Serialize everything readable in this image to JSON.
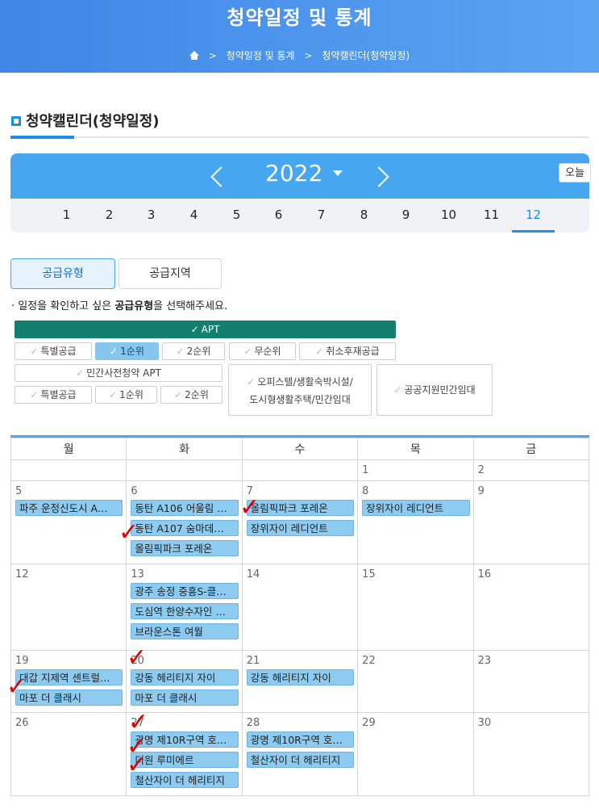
{
  "header": {
    "title": "청약일정 및 통계",
    "breadcrumb": [
      "청약일정 및 통계",
      "청약캘린더(청약일정)"
    ],
    "sep": ">"
  },
  "section": {
    "title": "청약캘린더(청약일정)"
  },
  "calendar_nav": {
    "year": "2022",
    "today_label": "오늘",
    "months": [
      "1",
      "2",
      "3",
      "4",
      "5",
      "6",
      "7",
      "8",
      "9",
      "10",
      "11",
      "12"
    ],
    "active_month": "12"
  },
  "tabs": {
    "supply_type": "공급유형",
    "supply_region": "공급지역"
  },
  "hint": {
    "prefix": "· 일정을 확인하고 싶은 ",
    "bold": "공급유형",
    "suffix": "을 선택해주세요."
  },
  "filters": {
    "apt": "APT",
    "special": "특별공급",
    "first": "1순위",
    "second": "2순위",
    "no_rank": "무순위",
    "cancel": "취소후재공급",
    "pre_sale": "민간사전청약 APT",
    "pre_special": "특별공급",
    "pre_first": "1순위",
    "pre_second": "2순위",
    "officetel_1": "오피스텔/생활숙박시설/",
    "officetel_2": "도시형생활주택/민간임대",
    "public_rental": "공공지원민간임대"
  },
  "weekdays": [
    "월",
    "화",
    "수",
    "목",
    "금"
  ],
  "weeks": [
    [
      {
        "day": "",
        "events": []
      },
      {
        "day": "",
        "events": []
      },
      {
        "day": "",
        "events": []
      },
      {
        "day": "1",
        "events": []
      },
      {
        "day": "2",
        "events": []
      }
    ],
    [
      {
        "day": "5",
        "events": [
          "파주 운정신도시 A…"
        ]
      },
      {
        "day": "6",
        "events": [
          "동탄 A106 어울림 …",
          "동탄 A107 숨마데…",
          "올림픽파크 포레온"
        ]
      },
      {
        "day": "7",
        "events": [
          "올림픽파크 포레온",
          "장위자이 레디언트"
        ]
      },
      {
        "day": "8",
        "events": [
          "장위자이 레디언트"
        ]
      },
      {
        "day": "9",
        "events": []
      }
    ],
    [
      {
        "day": "12",
        "events": []
      },
      {
        "day": "13",
        "events": [
          "광주 송정 중흥S-클…",
          "도심역 한양수자인 …",
          "브라운스톤 여월"
        ]
      },
      {
        "day": "14",
        "events": []
      },
      {
        "day": "15",
        "events": []
      },
      {
        "day": "16",
        "events": []
      }
    ],
    [
      {
        "day": "19",
        "events": [
          "대갑 지제역 센트럴…",
          "마포 더 클래시"
        ]
      },
      {
        "day": "20",
        "events": [
          "강동 헤리티지 자이",
          "마포 더 클래시"
        ]
      },
      {
        "day": "21",
        "events": [
          "강동 헤리티지 자이"
        ]
      },
      {
        "day": "22",
        "events": []
      },
      {
        "day": "23",
        "events": []
      }
    ],
    [
      {
        "day": "26",
        "events": []
      },
      {
        "day": "27",
        "events": [
          "광명 제10R구역 호…",
          "더원 루미에르",
          "철산자이 더 헤리티지"
        ]
      },
      {
        "day": "28",
        "events": [
          "광명 제10R구역 호…",
          "철산자이 더 헤리티지"
        ]
      },
      {
        "day": "29",
        "events": []
      },
      {
        "day": "30",
        "events": []
      }
    ]
  ],
  "check_mark": "✓",
  "colors": {
    "accent": "#1d8fe8",
    "event": "#8dcbf0",
    "apt_bar": "#137f6e",
    "check": "#e00000"
  }
}
